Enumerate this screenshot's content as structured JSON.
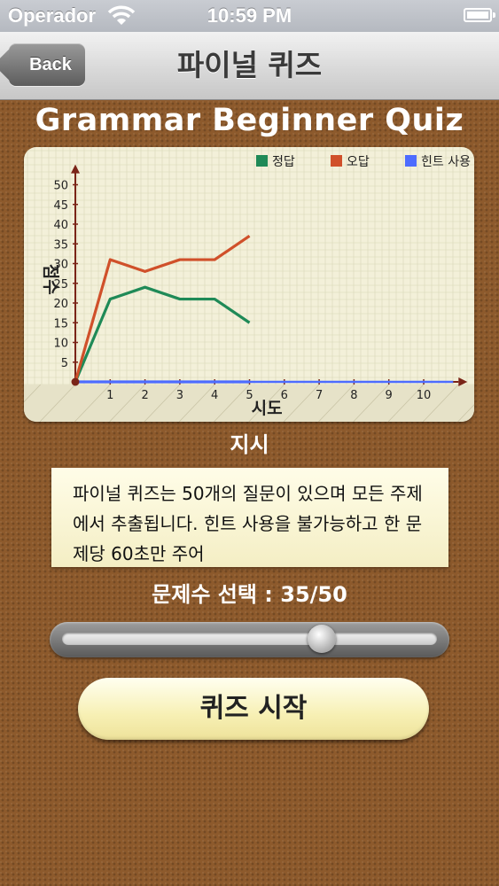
{
  "status_bar": {
    "carrier": "Operador",
    "time": "10:59 PM"
  },
  "nav": {
    "back_label": "Back",
    "title": "파이널 퀴즈"
  },
  "quiz_title": "Grammar Beginner Quiz",
  "chart_data": {
    "type": "line",
    "xlabel": "시도",
    "ylabel": "점수",
    "x_ticks": [
      1,
      2,
      3,
      4,
      5,
      6,
      7,
      8,
      9,
      10
    ],
    "y_ticks": [
      5,
      10,
      15,
      20,
      25,
      30,
      35,
      40,
      45,
      50
    ],
    "xlim": [
      0,
      11
    ],
    "ylim": [
      0,
      52
    ],
    "grid": true,
    "legend_position": "top-right",
    "x": [
      0,
      1,
      2,
      3,
      4,
      5
    ],
    "series": [
      {
        "name": "정답",
        "color": "#1f8a57",
        "values": [
          0,
          21,
          24,
          21,
          21,
          15
        ]
      },
      {
        "name": "오답",
        "color": "#d0502a",
        "values": [
          0,
          31,
          28,
          31,
          31,
          37
        ]
      },
      {
        "name": "힌트 사용",
        "color": "#4d6cff",
        "values": [
          0,
          0,
          0,
          0,
          0,
          0
        ]
      }
    ]
  },
  "directions": {
    "title": "지시",
    "text": "파이널 퀴즈는 50개의 질문이 있으며 모든 주제에서 추출됩니다. 힌트 사용을 불가능하고 한 문제당 60초만 주어"
  },
  "question_count": {
    "label": "문제수 선택 :",
    "value": "35/50",
    "selected": 35,
    "max": 50
  },
  "start_button": {
    "label": "퀴즈 시작"
  }
}
